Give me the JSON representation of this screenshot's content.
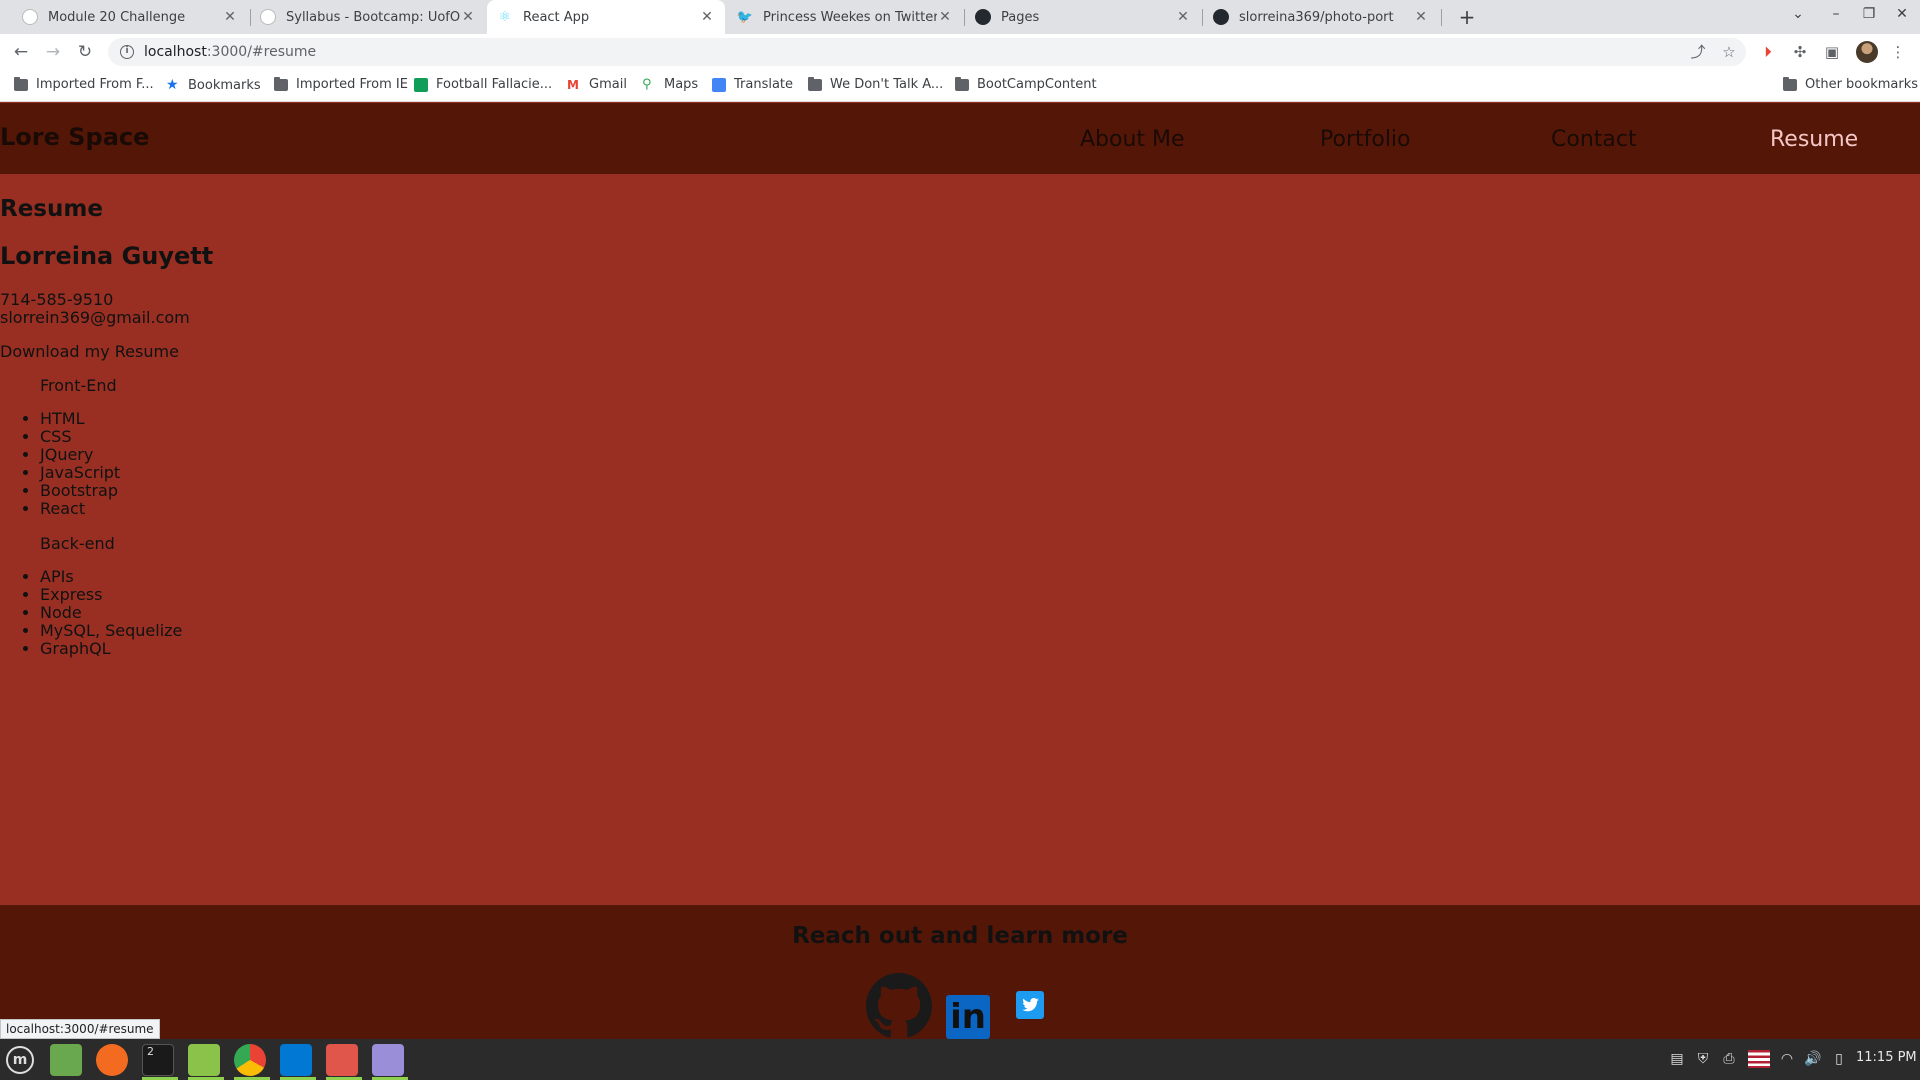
{
  "browser": {
    "tabs": [
      {
        "title": "Module 20 Challenge"
      },
      {
        "title": "Syllabus - Bootcamp: UofO-V"
      },
      {
        "title": "React App"
      },
      {
        "title": "Princess Weekes on Twitter: \""
      },
      {
        "title": "Pages"
      },
      {
        "title": "slorreina369/photo-port"
      }
    ],
    "url_host": "localhost",
    "url_path": ":3000/#resume",
    "bookmarks": [
      "Imported From F...",
      "Bookmarks",
      "Imported From IE",
      "Football Fallacie...",
      "Gmail",
      "Maps",
      "Translate",
      "We Don't Talk A...",
      "BootCampContent"
    ],
    "other_bookmarks": "Other bookmarks",
    "status_url": "localhost:3000/#resume"
  },
  "site": {
    "brand": "Lore Space",
    "nav": [
      "About Me",
      "Portfolio",
      "Contact",
      "Resume"
    ]
  },
  "resume": {
    "title": "Resume",
    "name": "Lorreina Guyett",
    "phone": "714-585-9510",
    "email": "slorrein369@gmail.com",
    "download": "Download my Resume",
    "frontend_title": "Front-End",
    "frontend": [
      "HTML",
      "CSS",
      "JQuery",
      "JavaScript",
      "Bootstrap",
      "React"
    ],
    "backend_title": "Back-end",
    "backend": [
      "APIs",
      "Express",
      "Node",
      "MySQL, Sequelize",
      "GraphQL"
    ]
  },
  "footer": {
    "title": "Reach out and learn more",
    "linkedin_text": "in"
  },
  "taskbar": {
    "terminal_badge": "2",
    "clock": "11:15 PM"
  },
  "colors": {
    "page_bg": "#992f22",
    "header_bg": "#541707",
    "nav_active": "#f5c6c6",
    "linkedin": "#0a66c2",
    "twitter": "#1d9bf0"
  }
}
